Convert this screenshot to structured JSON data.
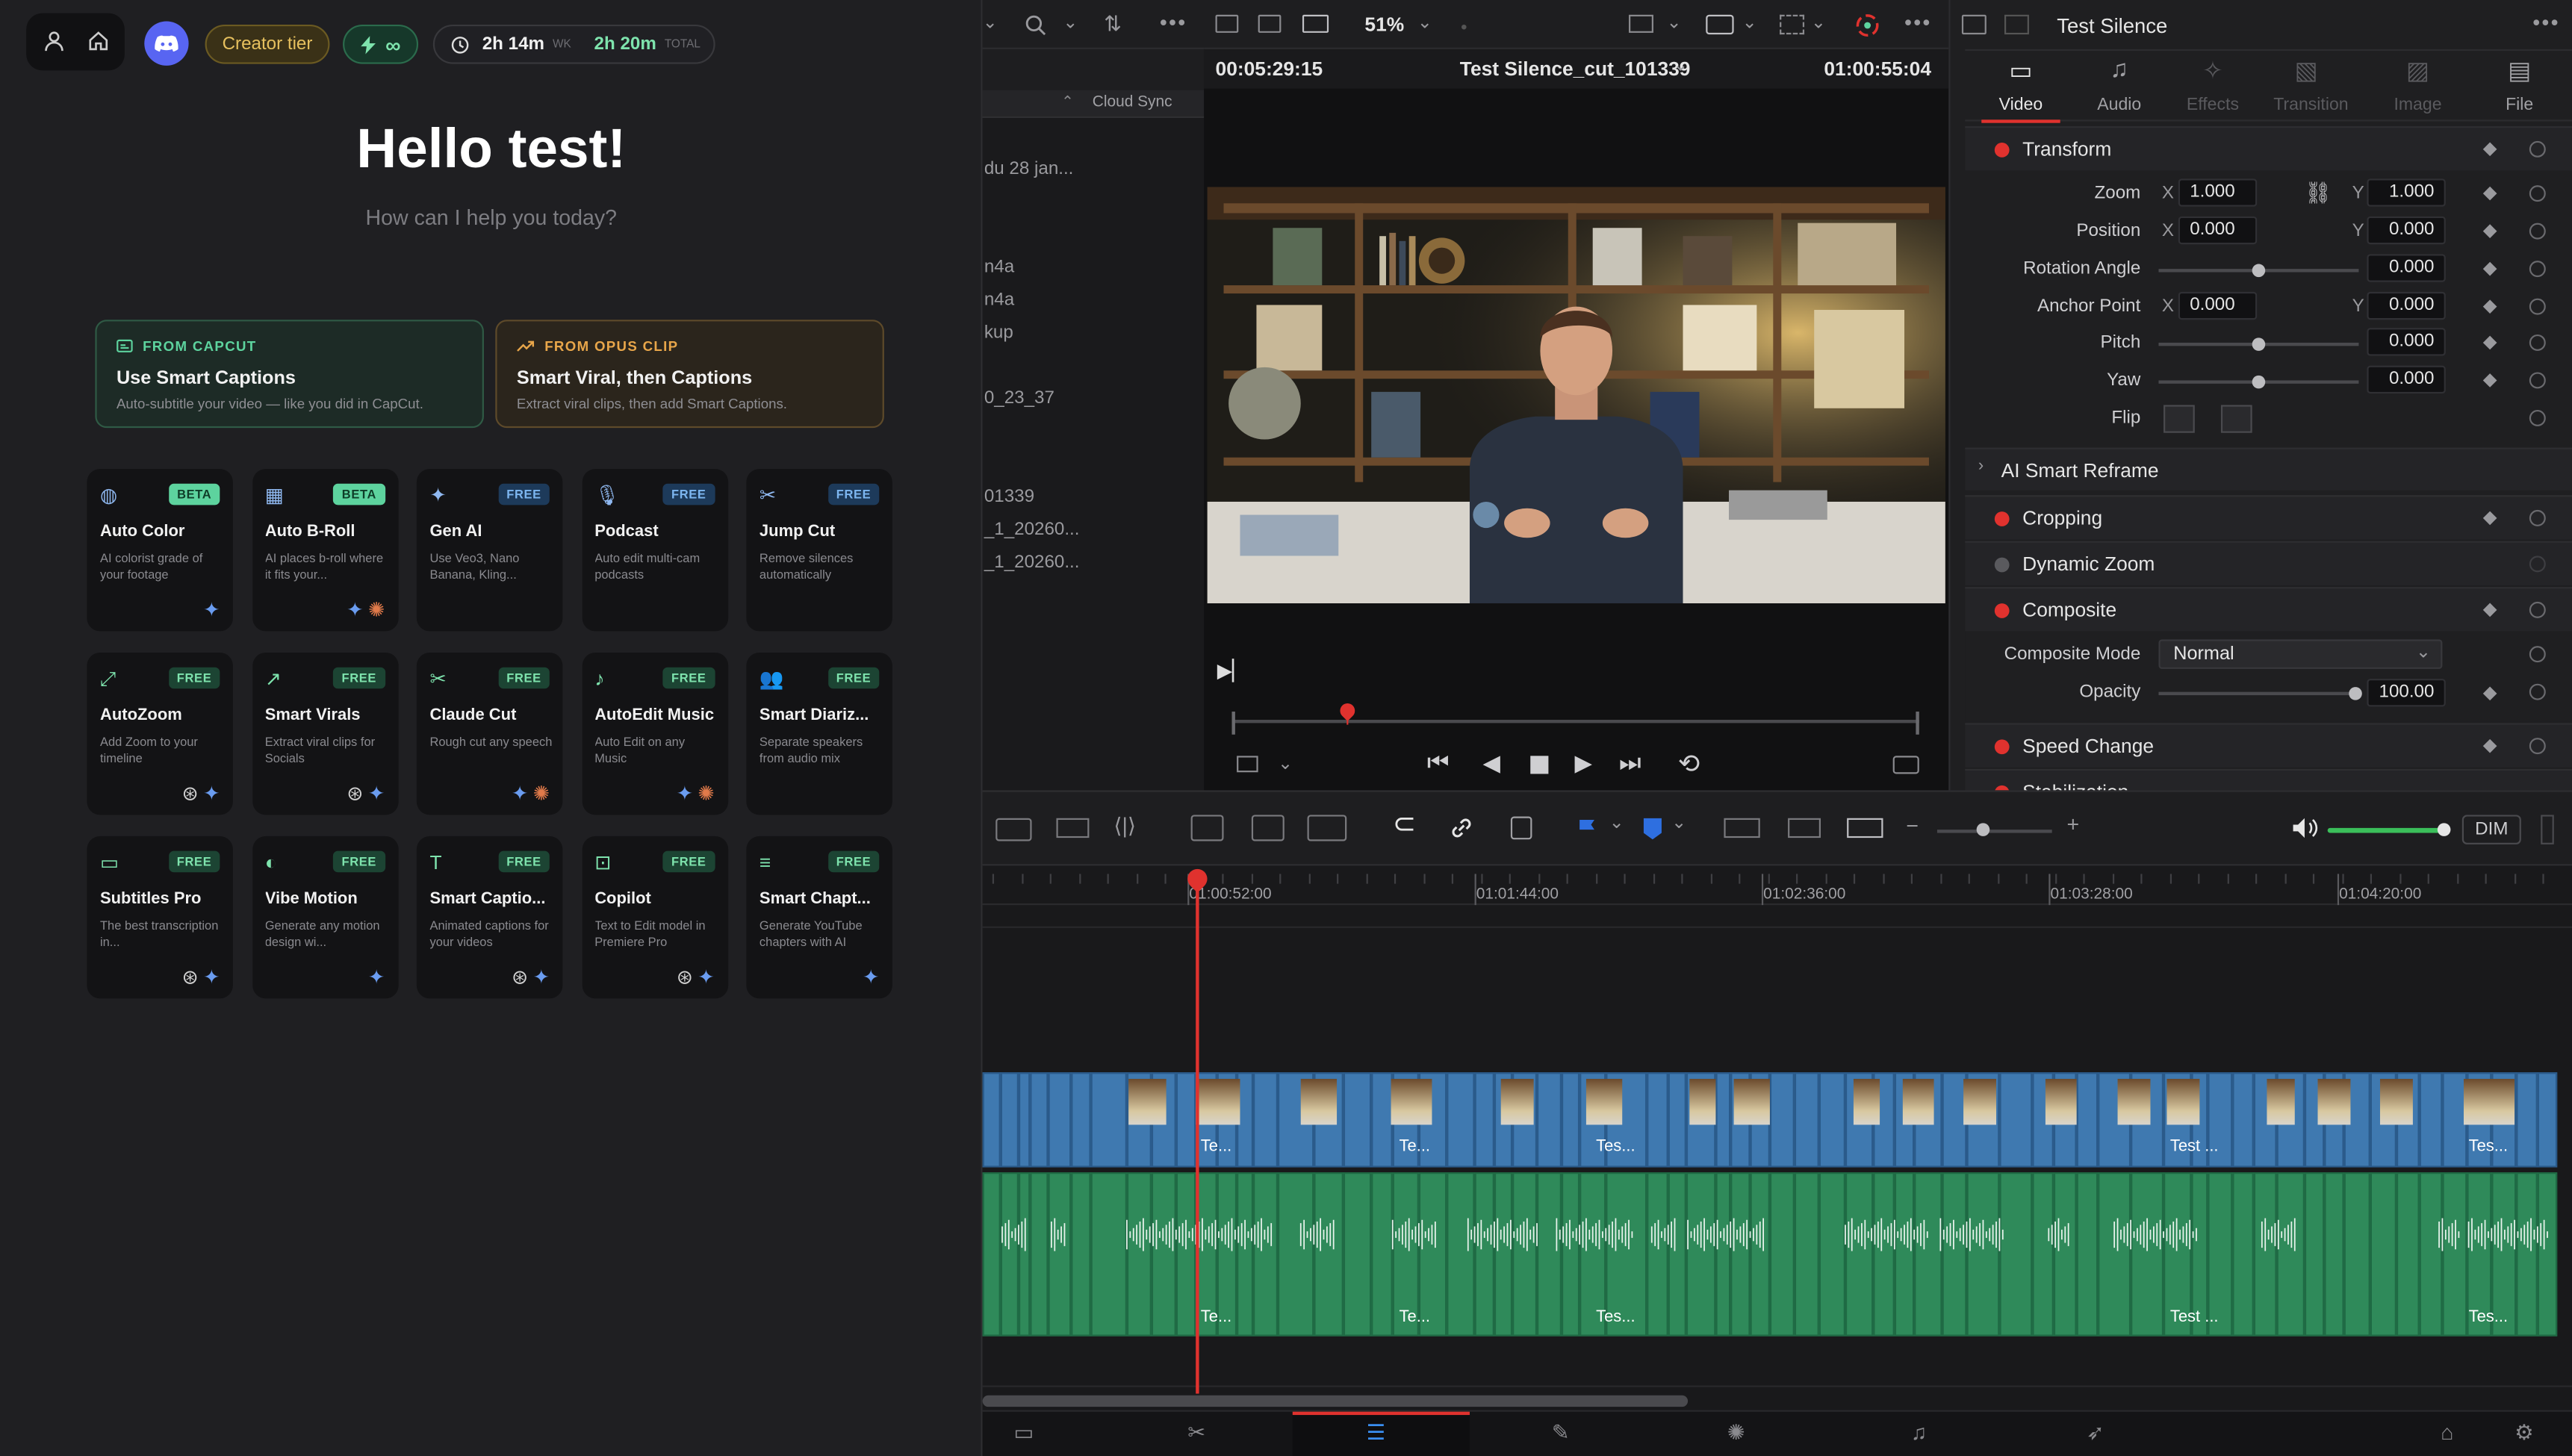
{
  "assistant": {
    "tier_label": "Creator tier",
    "credits_label": "∞",
    "time_week": "2h 14m",
    "time_week_suffix": "WK",
    "time_total": "2h 20m",
    "time_total_suffix": "TOTAL",
    "greeting": "Hello test!",
    "subtitle": "How can I help you today?",
    "promos": [
      {
        "kicker": "FROM CAPCUT",
        "title": "Use Smart Captions",
        "desc": "Auto-subtitle your video — like you did in CapCut.",
        "accent": "#5dd39e"
      },
      {
        "kicker": "FROM OPUS CLIP",
        "title": "Smart Viral, then Captions",
        "desc": "Extract viral clips, then add Smart Captions.",
        "accent": "#e8a64a"
      }
    ],
    "cards": [
      {
        "title": "Auto Color",
        "desc": "AI colorist grade of your footage",
        "badge": "BETA",
        "icon": "palette-icon"
      },
      {
        "title": "Auto B-Roll",
        "desc": "AI places b-roll where it fits your...",
        "badge": "BETA",
        "icon": "film-icon"
      },
      {
        "title": "Gen AI",
        "desc": "Use Veo3, Nano Banana, Kling...",
        "badge": "FREE",
        "icon": "sparkles-icon"
      },
      {
        "title": "Podcast",
        "desc": "Auto edit multi-cam podcasts",
        "badge": "FREE",
        "icon": "microphone-icon"
      },
      {
        "title": "Jump Cut",
        "desc": "Remove silences automatically",
        "badge": "FREE",
        "icon": "scissors-icon"
      },
      {
        "title": "AutoZoom",
        "desc": "Add Zoom to your timeline",
        "badge": "FREE",
        "icon": "expand-icon"
      },
      {
        "title": "Smart Virals",
        "desc": "Extract viral clips for Socials",
        "badge": "FREE",
        "icon": "trending-icon"
      },
      {
        "title": "Claude Cut",
        "desc": "Rough cut any speech",
        "badge": "FREE",
        "icon": "scissors-icon"
      },
      {
        "title": "AutoEdit Music",
        "desc": "Auto Edit on any Music",
        "badge": "FREE",
        "icon": "music-note-icon"
      },
      {
        "title": "Smart Diariz...",
        "desc": "Separate speakers from audio mix",
        "badge": "FREE",
        "icon": "users-icon"
      },
      {
        "title": "Subtitles Pro",
        "desc": "The best transcription in...",
        "badge": "FREE",
        "icon": "subtitles-icon"
      },
      {
        "title": "Vibe Motion",
        "desc": "Generate any motion design wi...",
        "badge": "FREE",
        "icon": "motion-icon"
      },
      {
        "title": "Smart Captio...",
        "desc": "Animated captions for your videos",
        "badge": "FREE",
        "icon": "text-icon"
      },
      {
        "title": "Copilot",
        "desc": "Text to Edit model in Premiere Pro",
        "badge": "FREE",
        "icon": "robot-icon"
      },
      {
        "title": "Smart Chapt...",
        "desc": "Generate YouTube chapters with AI",
        "badge": "FREE",
        "icon": "list-icon"
      }
    ]
  },
  "resolve": {
    "zoom_level": "51%",
    "cloud_sync": "Cloud Sync",
    "media_items": [
      "du 28 jan...",
      "n4a",
      "n4a",
      "kup",
      "0_23_37",
      "01339",
      "_1_20260...",
      "_1_20260..."
    ],
    "source_timecode": "00:05:29:15",
    "clip_name": "Test Silence_cut_101339",
    "record_timecode": "01:00:55:04",
    "inspector_title": "Test Silence",
    "inspector_tabs": [
      "Video",
      "Audio",
      "Effects",
      "Transition",
      "Image",
      "File"
    ],
    "transform": {
      "title": "Transform",
      "zoom_label": "Zoom",
      "zoom_x": "1.000",
      "zoom_y": "1.000",
      "position_label": "Position",
      "pos_x": "0.000",
      "pos_y": "0.000",
      "rotation_label": "Rotation Angle",
      "rotation": "0.000",
      "anchor_label": "Anchor Point",
      "anchor_x": "0.000",
      "anchor_y": "0.000",
      "pitch_label": "Pitch",
      "pitch": "0.000",
      "yaw_label": "Yaw",
      "yaw": "0.000",
      "flip_label": "Flip",
      "x": "X",
      "y": "Y"
    },
    "sections": {
      "smart_reframe": "AI Smart Reframe",
      "cropping": "Cropping",
      "dynamic_zoom": "Dynamic Zoom",
      "composite": "Composite",
      "composite_mode_label": "Composite Mode",
      "composite_mode": "Normal",
      "opacity_label": "Opacity",
      "opacity": "100.00",
      "speed_change": "Speed Change",
      "stabilization": "Stabilization"
    },
    "dim_label": "DIM",
    "ruler": [
      "01:00:52:00",
      "01:01:44:00",
      "01:02:36:00",
      "01:03:28:00",
      "01:04:20:00"
    ],
    "clip_labels": [
      "Te...",
      "Te...",
      "Tes...",
      "Test ...",
      "Tes..."
    ]
  }
}
